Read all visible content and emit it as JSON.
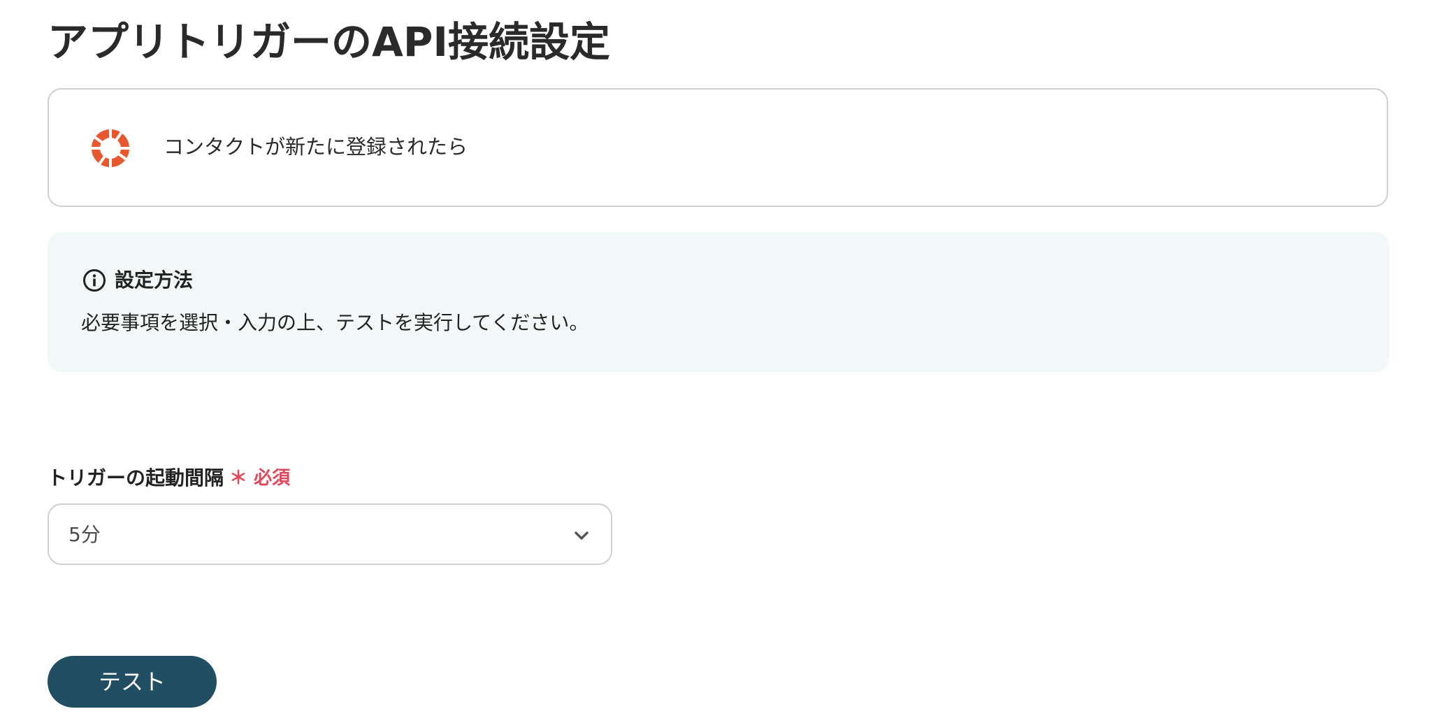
{
  "page": {
    "title": "アプリトリガーのAPI接続設定"
  },
  "trigger_card": {
    "app_icon": "hubspot-lifebuoy-logo",
    "label": "コンタクトが新たに登録されたら"
  },
  "info_box": {
    "icon": "info-circle-icon",
    "title": "設定方法",
    "text": "必要事項を選択・入力の上、テストを実行してください。"
  },
  "interval_field": {
    "label": "トリガーの起動間隔",
    "required_label": "＊ 必須",
    "selected_value": "5分",
    "dropdown_icon": "chevron-down-icon"
  },
  "actions": {
    "test_button_label": "テスト"
  },
  "colors": {
    "accent_button": "#214e63",
    "required_red": "#e0475b",
    "info_background": "#f2f8f8",
    "logo_orange": "#e8572e",
    "border_gray": "#cfcfcf"
  }
}
